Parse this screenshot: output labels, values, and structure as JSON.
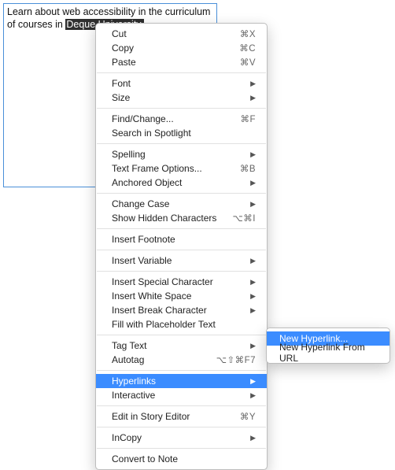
{
  "text_frame": {
    "prefix": "Learn about web accessibility in the curriculum of courses in ",
    "selected": "Deque University.",
    "after": ""
  },
  "menu": {
    "groups": [
      [
        {
          "id": "cut",
          "label": "Cut",
          "shortcut": "⌘X",
          "sub": false
        },
        {
          "id": "copy",
          "label": "Copy",
          "shortcut": "⌘C",
          "sub": false
        },
        {
          "id": "paste",
          "label": "Paste",
          "shortcut": "⌘V",
          "sub": false
        }
      ],
      [
        {
          "id": "font",
          "label": "Font",
          "shortcut": "",
          "sub": true
        },
        {
          "id": "size",
          "label": "Size",
          "shortcut": "",
          "sub": true
        }
      ],
      [
        {
          "id": "find-change",
          "label": "Find/Change...",
          "shortcut": "⌘F",
          "sub": false
        },
        {
          "id": "search-spotlight",
          "label": "Search in Spotlight",
          "shortcut": "",
          "sub": false
        }
      ],
      [
        {
          "id": "spelling",
          "label": "Spelling",
          "shortcut": "",
          "sub": true
        },
        {
          "id": "text-frame-options",
          "label": "Text Frame Options...",
          "shortcut": "⌘B",
          "sub": false
        },
        {
          "id": "anchored-object",
          "label": "Anchored Object",
          "shortcut": "",
          "sub": true
        }
      ],
      [
        {
          "id": "change-case",
          "label": "Change Case",
          "shortcut": "",
          "sub": true
        },
        {
          "id": "show-hidden-characters",
          "label": "Show Hidden Characters",
          "shortcut": "⌥⌘I",
          "sub": false
        }
      ],
      [
        {
          "id": "insert-footnote",
          "label": "Insert Footnote",
          "shortcut": "",
          "sub": false
        }
      ],
      [
        {
          "id": "insert-variable",
          "label": "Insert Variable",
          "shortcut": "",
          "sub": true
        }
      ],
      [
        {
          "id": "insert-special-character",
          "label": "Insert Special Character",
          "shortcut": "",
          "sub": true
        },
        {
          "id": "insert-white-space",
          "label": "Insert White Space",
          "shortcut": "",
          "sub": true
        },
        {
          "id": "insert-break-character",
          "label": "Insert Break Character",
          "shortcut": "",
          "sub": true
        },
        {
          "id": "fill-placeholder",
          "label": "Fill with Placeholder Text",
          "shortcut": "",
          "sub": false
        }
      ],
      [
        {
          "id": "tag-text",
          "label": "Tag Text",
          "shortcut": "",
          "sub": true
        },
        {
          "id": "autotag",
          "label": "Autotag",
          "shortcut": "⌥⇧⌘F7",
          "sub": false
        }
      ],
      [
        {
          "id": "hyperlinks",
          "label": "Hyperlinks",
          "shortcut": "",
          "sub": true,
          "highlighted": true
        },
        {
          "id": "interactive",
          "label": "Interactive",
          "shortcut": "",
          "sub": true
        }
      ],
      [
        {
          "id": "edit-story-editor",
          "label": "Edit in Story Editor",
          "shortcut": "⌘Y",
          "sub": false
        }
      ],
      [
        {
          "id": "incopy",
          "label": "InCopy",
          "shortcut": "",
          "sub": true
        }
      ],
      [
        {
          "id": "convert-to-note",
          "label": "Convert to Note",
          "shortcut": "",
          "sub": false
        }
      ]
    ]
  },
  "submenu": {
    "items": [
      {
        "id": "new-hyperlink",
        "label": "New Hyperlink...",
        "highlighted": true
      },
      {
        "id": "new-hyperlink-from-url",
        "label": "New Hyperlink From URL"
      }
    ]
  }
}
